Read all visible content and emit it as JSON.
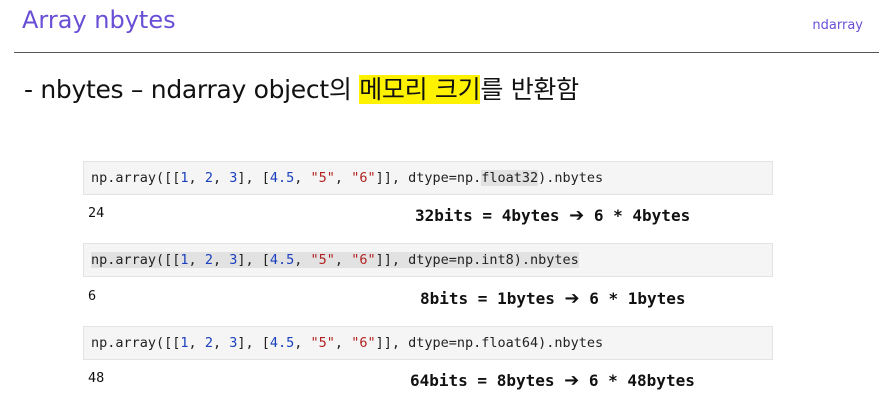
{
  "header": {
    "title": "Array nbytes",
    "tag": "ndarray"
  },
  "headline": {
    "prefix": "- nbytes – ndarray object의 ",
    "highlight": "메모리 크기",
    "suffix": "를 반환함"
  },
  "cells": [
    {
      "code": {
        "p1": "np.array([[",
        "n1": "1",
        "s1": ", ",
        "n2": "2",
        "s2": ", ",
        "n3": "3",
        "s3": "], [",
        "n4": "4.5",
        "s4": ", ",
        "str1": "\"5\"",
        "s5": ", ",
        "str2": "\"6\"",
        "s6": "]], dtype=np.",
        "dtype": "float32",
        "tail": ").nbytes"
      },
      "output": "24",
      "note": {
        "lhs": "32bits = 4bytes",
        "arrow": "➔",
        "rhs": "6 * 4bytes"
      }
    },
    {
      "code": {
        "p1": "np.array([[",
        "n1": "1",
        "s1": ", ",
        "n2": "2",
        "s2": ", ",
        "n3": "3",
        "s3": "], [",
        "n4": "4.5",
        "s4": ", ",
        "str1": "\"5\"",
        "s5": ", ",
        "str2": "\"6\"",
        "s6": "]], dtype=np.",
        "dtype": "int8",
        "tail": ").nbytes"
      },
      "output": "6",
      "note": {
        "lhs": "8bits = 1bytes",
        "arrow": "➔",
        "rhs": "6 * 1bytes"
      }
    },
    {
      "code": {
        "p1": "np.array([[",
        "n1": "1",
        "s1": ", ",
        "n2": "2",
        "s2": ", ",
        "n3": "3",
        "s3": "], [",
        "n4": "4.5",
        "s4": ", ",
        "str1": "\"5\"",
        "s5": ", ",
        "str2": "\"6\"",
        "s6": "]], dtype=np.",
        "dtype": "float64",
        "tail": ").nbytes"
      },
      "output": "48",
      "note": {
        "lhs": "64bits = 8bytes",
        "arrow": "➔",
        "rhs": "6 * 48bytes"
      }
    }
  ]
}
